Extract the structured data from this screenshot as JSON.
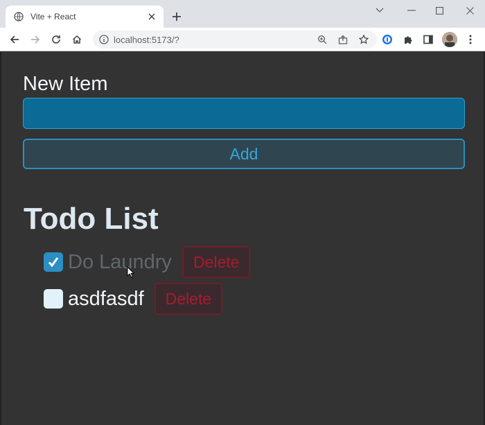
{
  "browser": {
    "tab": {
      "title": "Vite + React",
      "favicon": "globe-icon",
      "close_icon": "close-icon"
    },
    "new_tab_icon": "plus-icon",
    "window_controls": [
      "chevron-down-icon",
      "minimize-icon",
      "maximize-icon",
      "close-icon"
    ],
    "nav": [
      "back-icon",
      "forward-icon",
      "reload-icon",
      "home-icon"
    ],
    "address_bar": {
      "url": "localhost:5173/?",
      "icons": [
        "zoom-icon",
        "share-icon",
        "star-icon"
      ]
    },
    "extensions": [
      "extension-1password-icon",
      "puzzle-icon",
      "sidepanel-icon",
      "profile-avatar",
      "menu-kebab-icon"
    ]
  },
  "app": {
    "new_item_label": "New Item",
    "new_item_value": "",
    "add_label": "Add",
    "list_title": "Todo List",
    "todos": [
      {
        "text": "Do Laundry",
        "completed": true,
        "delete_label": "Delete"
      },
      {
        "text": "asdfasdf",
        "completed": false,
        "delete_label": "Delete"
      }
    ]
  },
  "colors": {
    "background": "#333333",
    "input_bg": "#0c6b96",
    "accent": "#2b8fc1",
    "delete": "#a81a30"
  }
}
